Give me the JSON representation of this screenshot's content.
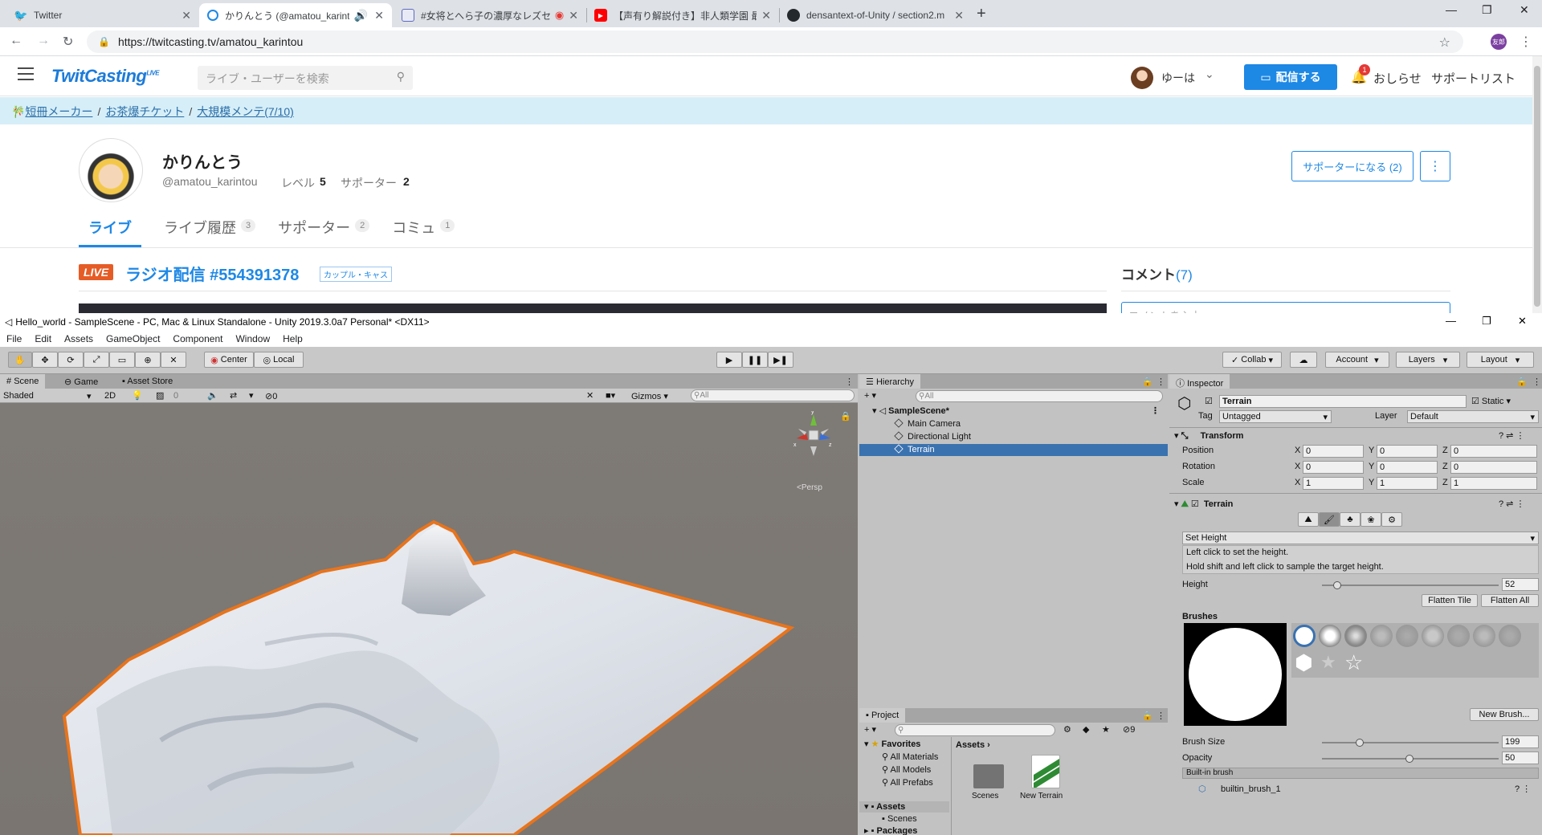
{
  "browser": {
    "tabs": [
      {
        "title": "Twitter",
        "icon": "twitter-bird-icon"
      },
      {
        "title": "かりんとう (@amatou_karintou",
        "icon": "twitcasting-icon"
      },
      {
        "title": "#女将とへら子の濃厚なレズセ",
        "icon": "tab-app-icon"
      },
      {
        "title": "【声有り解説付き】非人類学園 最強",
        "icon": "youtube-icon"
      },
      {
        "title": "densantext-of-Unity / section2.m",
        "icon": "github-icon"
      }
    ],
    "url": "https://twitcasting.tv/amatou_karintou",
    "profile_initials": "友郎"
  },
  "twitcasting": {
    "logo": "TwitCasting",
    "logo_sup": "LIVE",
    "search_placeholder": "ライブ・ユーザーを検索",
    "username": "ゆーは",
    "broadcast_label": "配信する",
    "notice_label": "おしらせ",
    "notice_count": "1",
    "support_list_label": "サポートリスト",
    "banner_links": [
      "短冊メーカー",
      "お茶爆チケット",
      "大規模メンテ(7/10)"
    ],
    "profile": {
      "name": "かりんとう",
      "handle": "@amatou_karintou",
      "level_label": "レベル",
      "level_value": "5",
      "supporter_label": "サポーター",
      "supporter_value": "2",
      "become_supporter": "サポーターになる (2)"
    },
    "tabs": [
      {
        "label": "ライブ",
        "count": ""
      },
      {
        "label": "ライブ履歴",
        "count": "3"
      },
      {
        "label": "サポーター",
        "count": "2"
      },
      {
        "label": "コミュ",
        "count": "1"
      }
    ],
    "live_badge": "LIVE",
    "live_title": "ラジオ配信 #554391378",
    "live_tag": "カップル・キャス",
    "comment_heading": "コメント",
    "comment_count": "(7)",
    "comment_placeholder": "コメントを入力"
  },
  "unity": {
    "window_title": "Hello_world - SampleScene - PC, Mac & Linux Standalone - Unity 2019.3.0a7 Personal* <DX11>",
    "menu": [
      "File",
      "Edit",
      "Assets",
      "GameObject",
      "Component",
      "Window",
      "Help"
    ],
    "pivot_center": "Center",
    "pivot_local": "Local",
    "collab": "Collab",
    "account": "Account",
    "layers": "Layers",
    "layout": "Layout",
    "scene_tabs": [
      "Scene",
      "Game",
      "Asset Store"
    ],
    "shading": "Shaded",
    "mode_2d": "2D",
    "gizmos": "Gizmos",
    "search_all": "All",
    "persp": "Persp",
    "fx_count": "0",
    "hidden_count": "0",
    "hierarchy": {
      "title": "Hierarchy",
      "scene": "SampleScene*",
      "items": [
        "Main Camera",
        "Directional Light",
        "Terrain"
      ],
      "selected": "Terrain"
    },
    "project": {
      "title": "Project",
      "favorites": "Favorites",
      "fav_items": [
        "All Materials",
        "All Models",
        "All Prefabs"
      ],
      "assets": "Assets",
      "asset_children": [
        "Scenes"
      ],
      "packages": "Packages",
      "breadcrumb": "Assets",
      "files": [
        "Scenes",
        "New Terrain"
      ],
      "hidden_count": "9"
    },
    "inspector": {
      "title": "Inspector",
      "object_name": "Terrain",
      "static_label": "Static",
      "tag_label": "Tag",
      "tag_value": "Untagged",
      "layer_label": "Layer",
      "layer_value": "Default",
      "transform": "Transform",
      "rows": [
        {
          "label": "Position",
          "x": "0",
          "y": "0",
          "z": "0"
        },
        {
          "label": "Rotation",
          "x": "0",
          "y": "0",
          "z": "0"
        },
        {
          "label": "Scale",
          "x": "1",
          "y": "1",
          "z": "1"
        }
      ],
      "terrain": "Terrain",
      "tool_mode": "Set Height",
      "help_1": "Left click to set the height.",
      "help_2": "Hold shift and left click to sample the target height.",
      "height_label": "Height",
      "height_value": "52",
      "flatten_tile": "Flatten Tile",
      "flatten_all": "Flatten All",
      "brushes": "Brushes",
      "new_brush": "New Brush...",
      "brush_size_label": "Brush Size",
      "brush_size_value": "199",
      "opacity_label": "Opacity",
      "opacity_value": "50",
      "builtin_brush": "Built-in brush",
      "builtin_brush_item": "builtin_brush_1"
    }
  }
}
